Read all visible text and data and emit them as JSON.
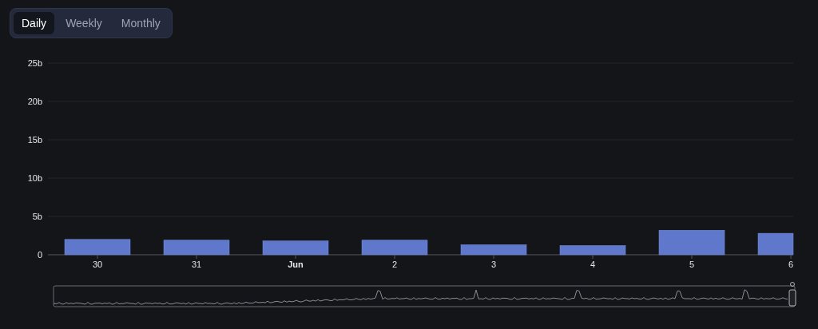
{
  "period_tabs": [
    {
      "label": "Daily",
      "selected": true
    },
    {
      "label": "Weekly",
      "selected": false
    },
    {
      "label": "Monthly",
      "selected": false
    }
  ],
  "chart": {
    "chart_data": {
      "type": "bar",
      "categories": [
        "30",
        "31",
        "Jun",
        "2",
        "3",
        "4",
        "5",
        "6"
      ],
      "series": [
        {
          "color": "#5f78cc",
          "values": [
            2.0,
            1.9,
            1.8,
            1.9,
            1.3,
            1.2,
            3.2,
            2.8
          ]
        }
      ],
      "ylim": [
        0,
        25
      ],
      "yticks": [
        {
          "value": 0,
          "label": "0"
        },
        {
          "value": 5,
          "label": "5b"
        },
        {
          "value": 10,
          "label": "10b"
        },
        {
          "value": 15,
          "label": "15b"
        },
        {
          "value": 20,
          "label": "20b"
        },
        {
          "value": 25,
          "label": "25b"
        }
      ],
      "grid": true
    }
  }
}
